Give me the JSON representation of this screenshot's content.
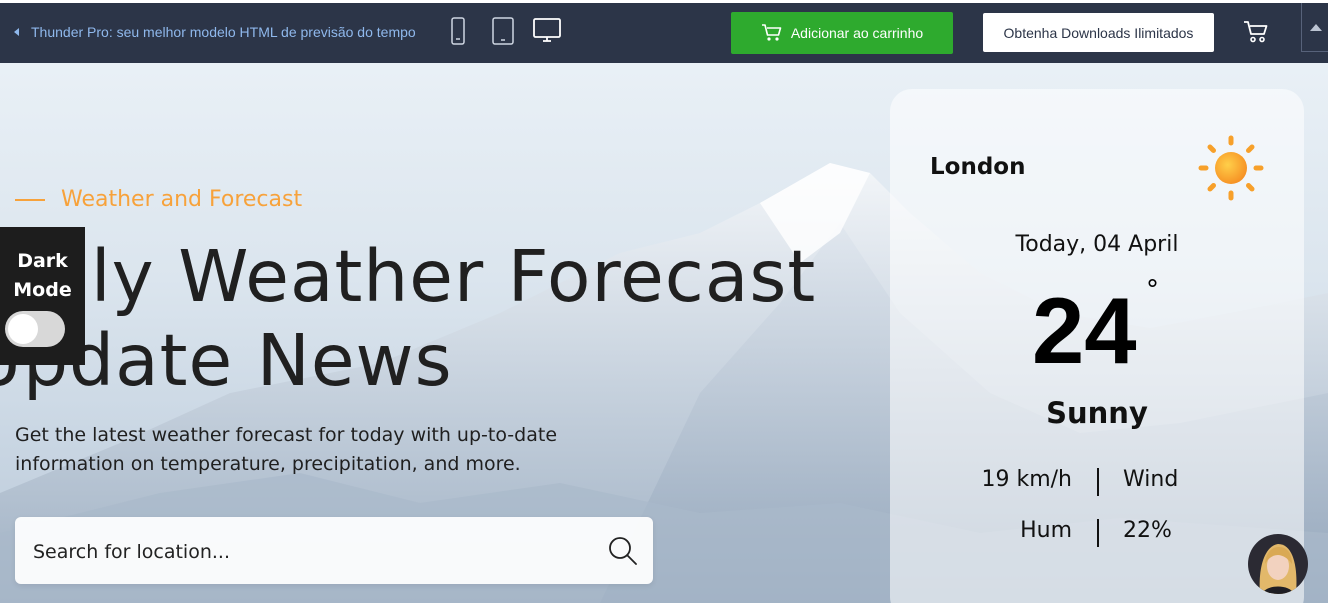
{
  "topbar": {
    "back_text": "Thunder Pro: seu melhor modelo HTML de previsão do tempo",
    "add_to_cart": "Adicionar ao carrinho",
    "downloads": "Obtenha Downloads Ilimitados"
  },
  "hero": {
    "kicker": "Weather and Forecast",
    "headline_line1": "Daily Weather Forecast",
    "headline_line2": "Update News",
    "lead": "Get the latest weather forecast for today with up-to-date information on temperature, precipitation, and more.",
    "search_placeholder": "Search for location..."
  },
  "darkmode": {
    "label_line1": "Dark",
    "label_line2": "Mode"
  },
  "weather": {
    "city": "London",
    "date": "Today, 04 April",
    "temperature": "24",
    "degree_symbol": "°",
    "condition": "Sunny",
    "wind_value": "19 km/h",
    "wind_label": "Wind",
    "hum_label": "Hum",
    "hum_value": "22%"
  },
  "colors": {
    "topbar": "#2c3548",
    "cart_button": "#2eaa2e",
    "accent": "#f7a23b"
  }
}
